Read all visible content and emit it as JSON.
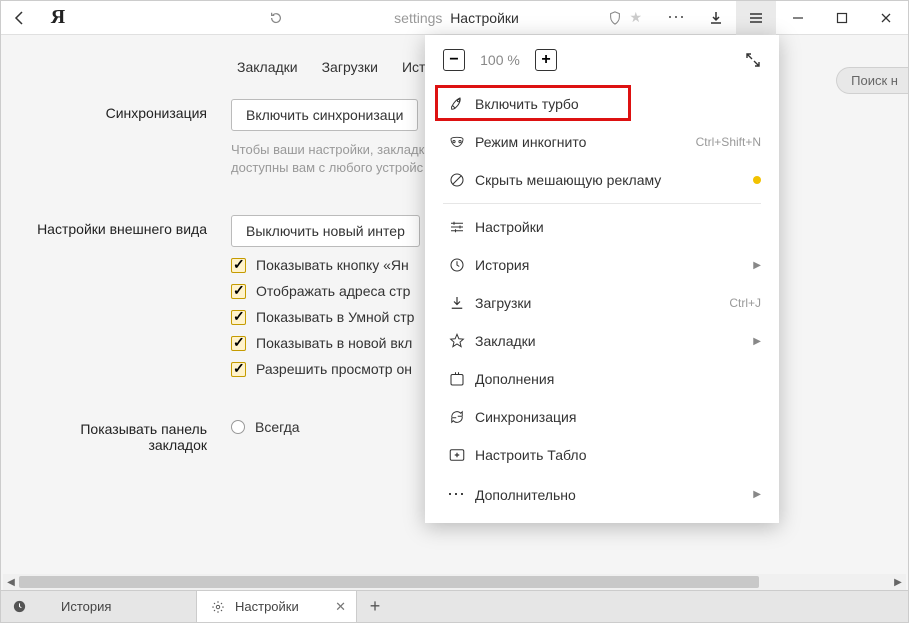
{
  "toolbar": {
    "omnibox_prefix": "settings",
    "omnibox_title": "Настройки"
  },
  "nav": {
    "bookmarks": "Закладки",
    "downloads": "Загрузки",
    "history": "Ист"
  },
  "search": {
    "placeholder": "Поиск н"
  },
  "sections": {
    "sync": {
      "label": "Синхронизация",
      "button": "Включить синхронизаци",
      "hint1": "Чтобы ваши настройки, закладк",
      "hint2": "доступны вам с любого устройс"
    },
    "appearance": {
      "label": "Настройки внешнего вида",
      "button": "Выключить новый интер",
      "check1": "Показывать кнопку «Ян",
      "check2": "Отображать адреса стр",
      "check3": "Показывать в Умной стр",
      "check4": "Показывать в новой вкл",
      "check5": "Разрешить просмотр он"
    },
    "bookmarks_bar": {
      "label": "Показывать панель закладок",
      "radio1": "Всегда"
    }
  },
  "menu": {
    "zoom": "100 %",
    "turbo": "Включить турбо",
    "incognito": "Режим инкогнито",
    "incognito_sc": "Ctrl+Shift+N",
    "adblock": "Скрыть мешающую рекламу",
    "settings": "Настройки",
    "history": "История",
    "downloads": "Загрузки",
    "downloads_sc": "Ctrl+J",
    "bookmarks": "Закладки",
    "addons": "Дополнения",
    "sync": "Синхронизация",
    "tablo": "Настроить Табло",
    "more": "Дополнительно"
  },
  "tabs": {
    "history": "История",
    "settings": "Настройки"
  }
}
